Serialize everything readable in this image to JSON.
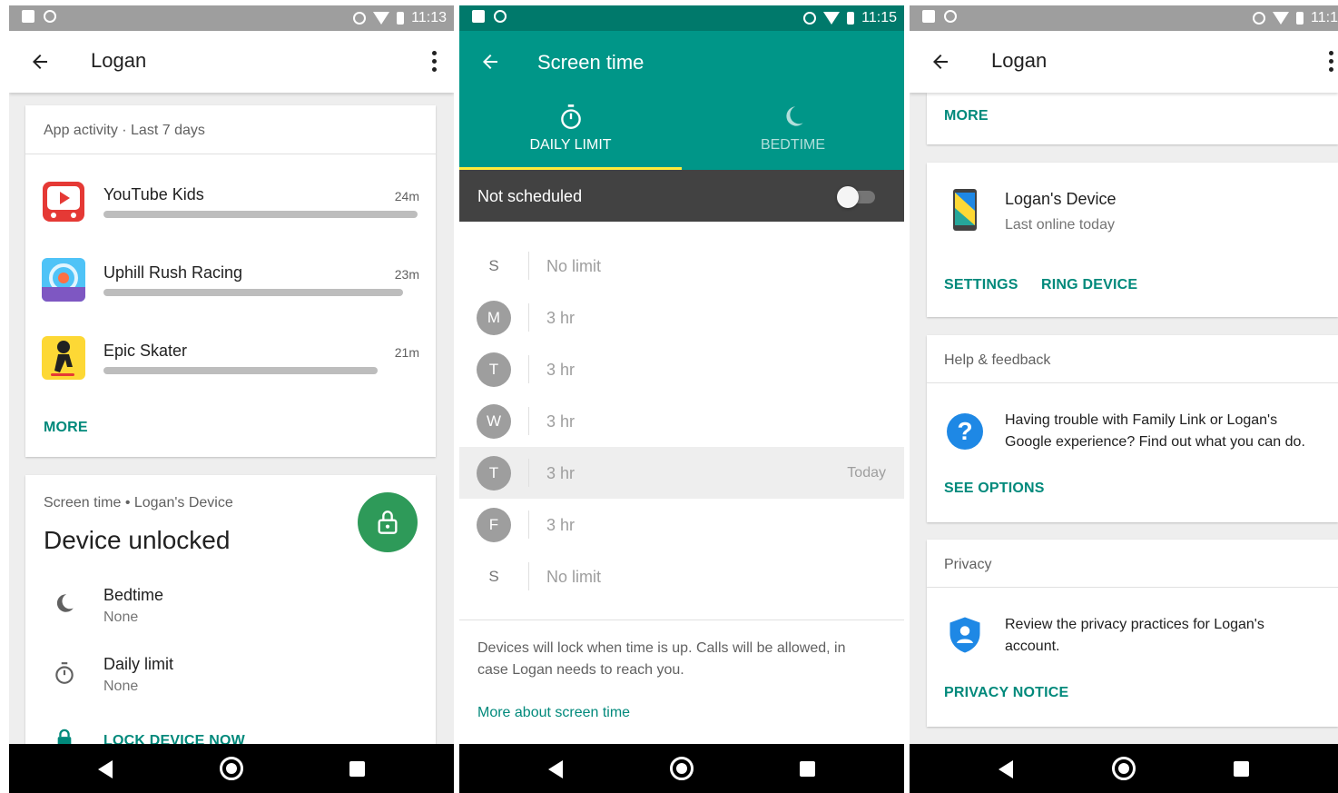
{
  "screens": [
    {
      "status_time": "11:13",
      "title": "Logan",
      "activity": {
        "header": "App activity · Last 7 days",
        "apps": [
          {
            "name": "YouTube Kids",
            "time": "24m",
            "share": 1.0
          },
          {
            "name": "Uphill Rush Racing",
            "time": "23m",
            "share": 0.955
          },
          {
            "name": "Epic Skater",
            "time": "21m",
            "share": 0.875
          }
        ],
        "more": "MORE"
      },
      "screen_time": {
        "header": "Screen time • Logan's Device",
        "status": "Device unlocked",
        "bedtime_label": "Bedtime",
        "bedtime_value": "None",
        "daily_label": "Daily limit",
        "daily_value": "None",
        "lock_now": "LOCK DEVICE NOW"
      }
    },
    {
      "status_time": "11:15",
      "title": "Screen time",
      "tabs": [
        "DAILY LIMIT",
        "BEDTIME"
      ],
      "schedule": "Not scheduled",
      "days": [
        {
          "letter": "S",
          "value": "No limit",
          "circle": false,
          "today": false
        },
        {
          "letter": "M",
          "value": "3 hr",
          "circle": true,
          "today": false
        },
        {
          "letter": "T",
          "value": "3 hr",
          "circle": true,
          "today": false
        },
        {
          "letter": "W",
          "value": "3 hr",
          "circle": true,
          "today": false
        },
        {
          "letter": "T",
          "value": "3 hr",
          "circle": true,
          "today": true
        },
        {
          "letter": "F",
          "value": "3 hr",
          "circle": true,
          "today": false
        },
        {
          "letter": "S",
          "value": "No limit",
          "circle": false,
          "today": false
        }
      ],
      "today_label": "Today",
      "info": "Devices will lock when time is up. Calls will be allowed, in case Logan needs to reach you.",
      "more_link": "More about screen time"
    },
    {
      "status_time": "11:1",
      "title": "Logan",
      "more": "MORE",
      "device": {
        "name": "Logan's Device",
        "status": "Last online today",
        "settings": "SETTINGS",
        "ring": "RING DEVICE"
      },
      "help": {
        "header": "Help & feedback",
        "text": "Having trouble with Family Link or Logan's Google experience? Find out what you can do.",
        "action": "SEE OPTIONS"
      },
      "privacy": {
        "header": "Privacy",
        "text": "Review the privacy practices for Logan's account.",
        "action": "PRIVACY NOTICE"
      }
    }
  ],
  "colors": {
    "accent": "#00897b",
    "teal": "#009688",
    "tab_indicator": "#ffeb3b",
    "lock_green": "#2e9a59"
  }
}
